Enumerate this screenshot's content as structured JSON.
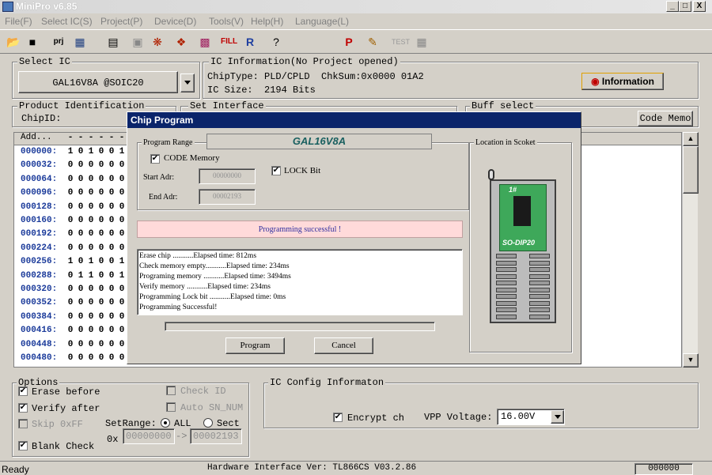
{
  "window": {
    "title": "MiniPro v6.85",
    "min": "_",
    "max": "□",
    "close": "X"
  },
  "menu": [
    "File(F)",
    "Select IC(S)",
    "Project(P)",
    "Device(D)",
    "Tools(V)",
    "Help(H)",
    "Language(L)"
  ],
  "select_ic": {
    "label": "Select IC",
    "value": "GAL16V8A @SOIC20"
  },
  "ic_info": {
    "label": "IC Information(No Project opened)",
    "chiptype": "ChipType: PLD/CPLD  ChkSum:0x0000 01A2",
    "icsize": "IC Size:  2194 Bits",
    "info_button": "Information"
  },
  "product": {
    "label": "Product Identification",
    "chipid": "ChipID:"
  },
  "set_interface": {
    "label": "Set Interface"
  },
  "buff": {
    "label": "Buff select",
    "code_memo": "Code Memo"
  },
  "grid": {
    "header": "Add...",
    "rows": [
      {
        "addr": "000000:",
        "cells": [
          "1",
          "0",
          "1",
          "0",
          "0",
          "1"
        ]
      },
      {
        "addr": "000032:",
        "cells": [
          "0",
          "0",
          "0",
          "0",
          "0",
          "0"
        ]
      },
      {
        "addr": "000064:",
        "cells": [
          "0",
          "0",
          "0",
          "0",
          "0",
          "0"
        ]
      },
      {
        "addr": "000096:",
        "cells": [
          "0",
          "0",
          "0",
          "0",
          "0",
          "0"
        ]
      },
      {
        "addr": "000128:",
        "cells": [
          "0",
          "0",
          "0",
          "0",
          "0",
          "0"
        ]
      },
      {
        "addr": "000160:",
        "cells": [
          "0",
          "0",
          "0",
          "0",
          "0",
          "0"
        ]
      },
      {
        "addr": "000192:",
        "cells": [
          "0",
          "0",
          "0",
          "0",
          "0",
          "0"
        ]
      },
      {
        "addr": "000224:",
        "cells": [
          "0",
          "0",
          "0",
          "0",
          "0",
          "0"
        ]
      },
      {
        "addr": "000256:",
        "cells": [
          "1",
          "0",
          "1",
          "0",
          "0",
          "1"
        ]
      },
      {
        "addr": "000288:",
        "cells": [
          "0",
          "1",
          "1",
          "0",
          "0",
          "1"
        ]
      },
      {
        "addr": "000320:",
        "cells": [
          "0",
          "0",
          "0",
          "0",
          "0",
          "0"
        ]
      },
      {
        "addr": "000352:",
        "cells": [
          "0",
          "0",
          "0",
          "0",
          "0",
          "0"
        ]
      },
      {
        "addr": "000384:",
        "cells": [
          "0",
          "0",
          "0",
          "0",
          "0",
          "0"
        ]
      },
      {
        "addr": "000416:",
        "cells": [
          "0",
          "0",
          "0",
          "0",
          "0",
          "0"
        ]
      },
      {
        "addr": "000448:",
        "cells": [
          "0",
          "0",
          "0",
          "0",
          "0",
          "0"
        ]
      },
      {
        "addr": "000480:",
        "cells": [
          "0",
          "0",
          "0",
          "0",
          "0",
          "0"
        ]
      }
    ]
  },
  "dialog": {
    "title": "Chip Program",
    "range_label": "Program Range",
    "chip_name": "GAL16V8A",
    "code_memory": "CODE Memory",
    "lock_bit": "LOCK Bit",
    "start_label": "Start Adr:",
    "start_value": "00000000",
    "end_label": "End Adr:",
    "end_value": "00002193",
    "status": "Programming successful !",
    "log": [
      "Erase chip ...........Elapsed time: 812ms",
      "Check memory empty...........Elapsed time: 234ms",
      "Programing memory ...........Elapsed time: 3494ms",
      "Verify memory ...........Elapsed time: 234ms",
      "Programming Lock bit ...........Elapsed time: 0ms",
      "Programming Successful!"
    ],
    "location_label": "Location in Scoket",
    "socket_label": "SO-DIP20",
    "pin1": "1#",
    "program_button": "Program",
    "cancel_button": "Cancel"
  },
  "options": {
    "label": "Options",
    "erase": "Erase before",
    "verify": "Verify after",
    "skip": "Skip 0xFF",
    "blank": "Blank Check",
    "check_id": "Check ID",
    "auto_sn": "Auto SN_NUM",
    "setrange": "SetRange:",
    "all": "ALL",
    "sect": "Sect",
    "ox": "0x",
    "from": "00000000",
    "arrow": "->",
    "to": "00002193"
  },
  "config": {
    "label": "IC Config Informaton",
    "encrypt": "Encrypt ch",
    "vpp_label": "VPP Voltage:",
    "vpp_value": "16.00V"
  },
  "status": {
    "ready": "Ready",
    "hw": "Hardware Interface Ver: TL866CS V03.2.86",
    "counter": "000000"
  }
}
